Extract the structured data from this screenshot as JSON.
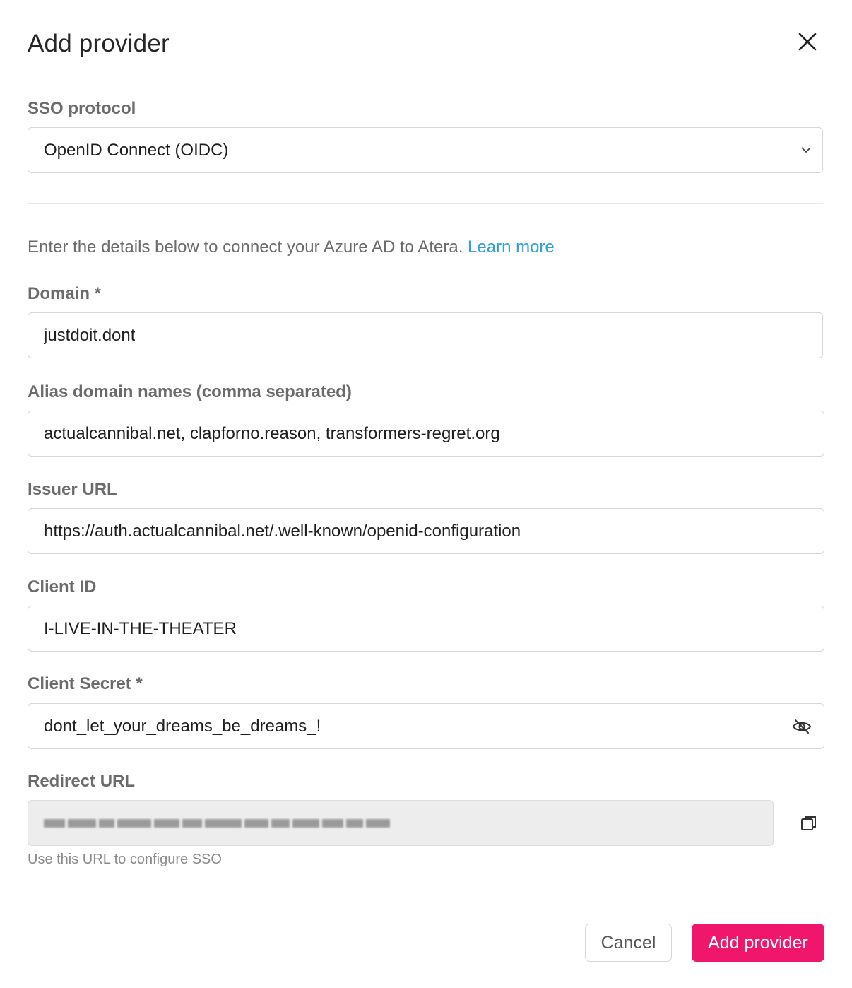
{
  "dialog": {
    "title": "Add provider"
  },
  "sso_protocol": {
    "label": "SSO protocol",
    "selected": "OpenID Connect (OIDC)"
  },
  "intro": {
    "text": "Enter the details below to connect your Azure AD to Atera.",
    "link": "Learn more"
  },
  "fields": {
    "domain": {
      "label": "Domain *",
      "value": "justdoit.dont"
    },
    "alias": {
      "label": "Alias domain names (comma separated)",
      "value": "actualcannibal.net, clapforno.reason, transformers-regret.org"
    },
    "issuer": {
      "label": "Issuer URL",
      "value": "https://auth.actualcannibal.net/.well-known/openid-configuration"
    },
    "client_id": {
      "label": "Client ID",
      "value": "I-LIVE-IN-THE-THEATER"
    },
    "client_secret": {
      "label": "Client Secret *",
      "value": "dont_let_your_dreams_be_dreams_!"
    },
    "redirect": {
      "label": "Redirect URL",
      "hint": "Use this URL to configure SSO"
    }
  },
  "buttons": {
    "cancel": "Cancel",
    "add": "Add provider"
  },
  "icons": {
    "close": "close-icon",
    "chevron": "chevron-down-icon",
    "eye": "eye-slash-icon",
    "copy": "copy-icon"
  },
  "colors": {
    "accent": "#f0166c",
    "link": "#2f9fd8"
  }
}
